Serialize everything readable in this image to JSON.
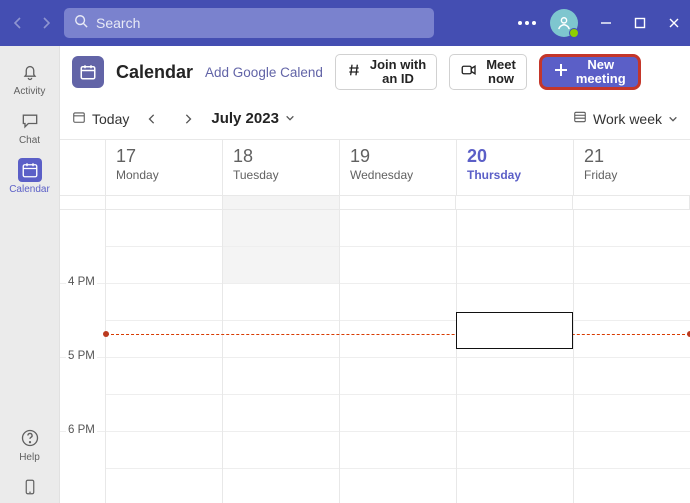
{
  "search": {
    "placeholder": "Search"
  },
  "rail": {
    "items": [
      {
        "id": "activity",
        "label": "Activity"
      },
      {
        "id": "chat",
        "label": "Chat"
      },
      {
        "id": "calendar",
        "label": "Calendar"
      },
      {
        "id": "help",
        "label": "Help"
      }
    ]
  },
  "header": {
    "title": "Calendar",
    "addLink": "Add Google Calend",
    "joinId": {
      "line1": "Join with",
      "line2": "an ID"
    },
    "meetNow": {
      "line1": "Meet",
      "line2": "now"
    },
    "newMeeting": {
      "line1": "New",
      "line2": "meeting"
    }
  },
  "toolbar": {
    "today": "Today",
    "month": "July 2023",
    "view": "Work week"
  },
  "days": [
    {
      "num": "17",
      "name": "Monday",
      "today": false
    },
    {
      "num": "18",
      "name": "Tuesday",
      "today": false
    },
    {
      "num": "19",
      "name": "Wednesday",
      "today": false
    },
    {
      "num": "20",
      "name": "Thursday",
      "today": true
    },
    {
      "num": "21",
      "name": "Friday",
      "today": false
    }
  ],
  "hours": [
    "",
    "4 PM",
    "5 PM",
    "6 PM"
  ],
  "nowLine": {
    "topPx": 124
  },
  "newEvent": {
    "dayIndex": 3,
    "topPx": 102,
    "heightPx": 37
  }
}
